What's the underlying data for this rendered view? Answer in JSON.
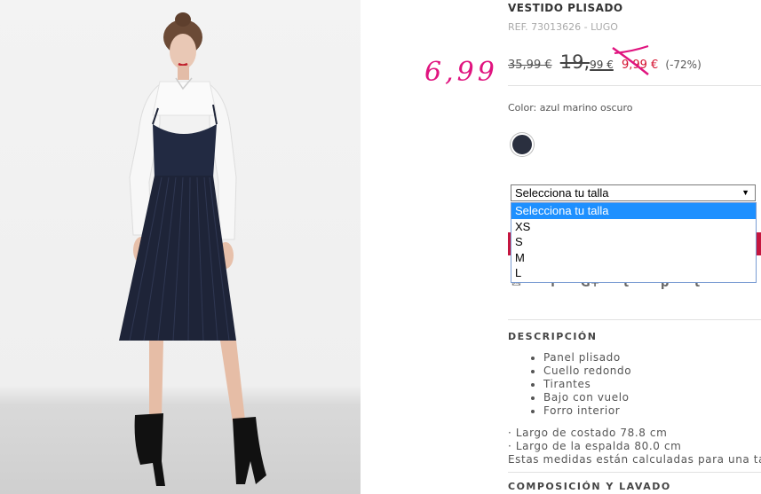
{
  "handwritten_price": "6,99",
  "product": {
    "title": "VESTIDO PLISADO",
    "ref": "REF. 73013626 - LUGO",
    "price_original_1": "35,99 €",
    "price_original_2_main": "19,",
    "price_original_2_cents": "99 €",
    "price_sale": "9,99 €",
    "discount": "(-72%)",
    "color_label": "Color: azul marino oscuro",
    "swatch_color": "#2a2f3f"
  },
  "size_select": {
    "selected": "Selecciona tu talla",
    "options": [
      "Selecciona tu talla",
      "XS",
      "S",
      "M",
      "L"
    ]
  },
  "share": {
    "icons": [
      "email-icon",
      "facebook-icon",
      "google-plus-icon",
      "twitter-icon",
      "pinterest-icon",
      "tumblr-icon"
    ],
    "glyphs": [
      "✉",
      "f",
      "G+",
      "t",
      "p",
      "t"
    ]
  },
  "description": {
    "heading": "DESCRIPCIÓN",
    "bullets": [
      "Panel plisado",
      "Cuello redondo",
      "Tirantes",
      "Bajo con vuelo",
      "Forro interior"
    ],
    "measure_1": "· Largo de costado 78.8 cm",
    "measure_2": "· Largo de la espalda 80.0 cm",
    "measure_note": "Estas medidas están calculadas para una tal"
  },
  "composition": {
    "heading": "COMPOSICIÓN Y LAVADO"
  },
  "colors": {
    "accent_pink": "#e0147f",
    "sale_red": "#d4102e",
    "select_highlight": "#1e90ff"
  }
}
